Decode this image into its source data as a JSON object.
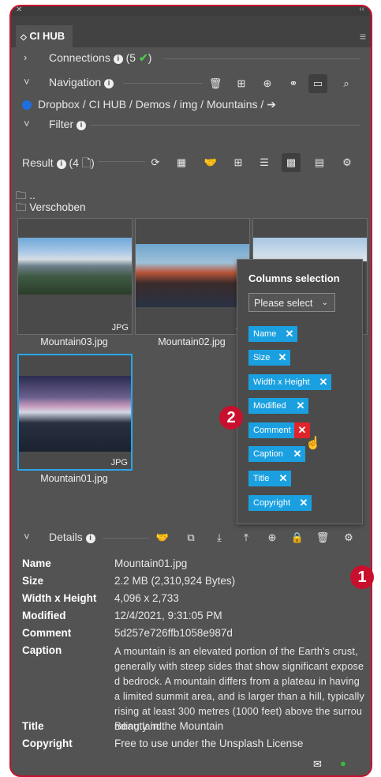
{
  "window": {
    "tab_label": "CI HUB"
  },
  "connections": {
    "label": "Connections",
    "count": "(5"
  },
  "navigation": {
    "label": "Navigation",
    "path": "Dropbox / CI HUB / Demos / img / Mountains / ➔"
  },
  "filter": {
    "label": "Filter"
  },
  "result": {
    "label": "Result",
    "count": "(4"
  },
  "folders": [
    "..",
    "Verschoben"
  ],
  "thumbnails": [
    {
      "name": "Mountain03.jpg",
      "ext": "JPG"
    },
    {
      "name": "Mountain02.jpg",
      "ext": "JP"
    },
    {
      "name": "Mountain01.jpg",
      "ext": "JPG"
    }
  ],
  "columns_popup": {
    "title": "Columns selection",
    "placeholder": "Please select",
    "tags": [
      "Name",
      "Size",
      "Width x Height",
      "Modified",
      "Comment",
      "Caption",
      "Title",
      "Copyright"
    ]
  },
  "badges": [
    "1",
    "2"
  ],
  "details": {
    "label": "Details",
    "rows": [
      {
        "label": "Name",
        "value": "Mountain01.jpg"
      },
      {
        "label": "Size",
        "value": "2.2 MB (2,310,924 Bytes)"
      },
      {
        "label": "Width x Height",
        "value": "4,096 x 2,733"
      },
      {
        "label": "Modified",
        "value": "12/4/2021, 9:31:05 PM"
      },
      {
        "label": "Comment",
        "value": "5d257e726ffb1058e987d"
      },
      {
        "label": "Caption",
        "value": "A mountain is an elevated portion of the Earth's crust, generally with steep sides that show significant exposed bedrock. A mountain differs from a plateau in having a limited summit area, and is larger than a hill, typically rising at least 300 metres (1000 feet) above the surrounding land."
      },
      {
        "label": "Title",
        "value": "Beauty in the Mountain"
      },
      {
        "label": "Copyright",
        "value": "Free to use under the Unsplash License"
      }
    ]
  },
  "colors": {
    "accent": "#1aa0e0",
    "badge": "#c8102e",
    "panel": "#535353"
  }
}
